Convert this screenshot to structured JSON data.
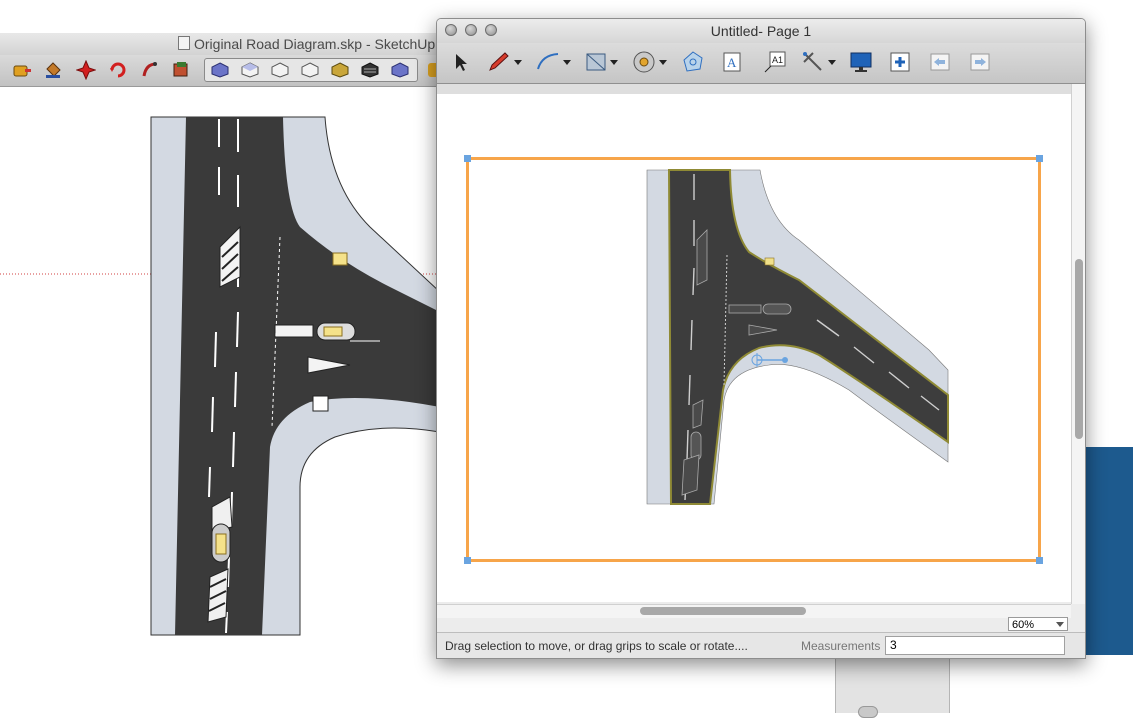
{
  "sketchup": {
    "window_title": "Original Road Diagram.skp - SketchUp",
    "toolbar": {
      "tools": [
        "tape-measure-icon",
        "paint-bucket-icon",
        "pan-icon",
        "orbit-icon",
        "walk-icon",
        "section-icon"
      ],
      "views": [
        "iso-view-icon",
        "top-view-icon",
        "front-view-icon",
        "right-view-icon",
        "back-view-icon",
        "left-view-icon",
        "bottom-view-icon"
      ]
    }
  },
  "layout_window": {
    "title": "Untitled- Page 1",
    "toolbar": [
      "select-tool-icon",
      "pencil-tool-icon",
      "arc-tool-icon",
      "rectangle-tool-icon",
      "circle-tool-icon",
      "polygon-tool-icon",
      "text-tool-icon",
      "label-tool-icon",
      "dimension-tool-icon",
      "presentation-icon",
      "add-page-icon",
      "previous-page-icon",
      "next-page-icon"
    ],
    "zoom": "60%",
    "status_text": "Drag selection to move, or drag grips to scale or rotate....",
    "measurements_label": "Measurements",
    "measurements_value": "3"
  },
  "colors": {
    "selection_border": "#f7a54a",
    "road_asphalt": "#3a3a3a",
    "sidewalk": "#d2d9e2",
    "grip": "#6aa4e0",
    "background_blue": "#1d5a8e"
  }
}
